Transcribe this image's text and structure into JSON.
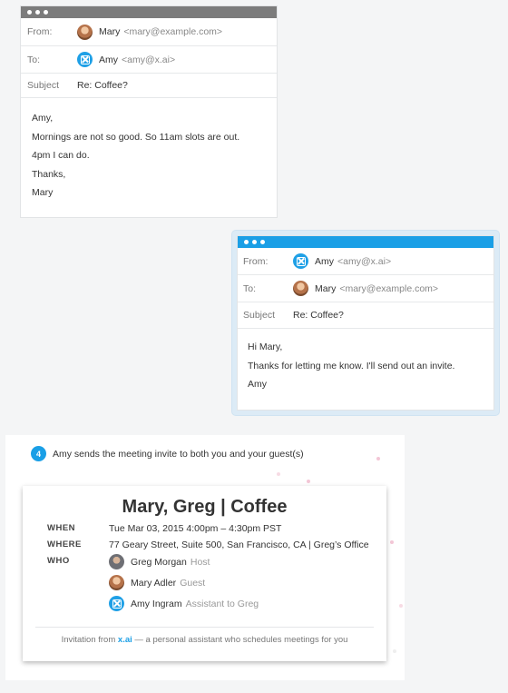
{
  "email1": {
    "from_label": "From:",
    "from_name": "Mary",
    "from_addr": "<mary@example.com>",
    "to_label": "To:",
    "to_name": "Amy",
    "to_addr": "<amy@x.ai>",
    "subject_label": "Subject",
    "subject": "Re: Coffee?",
    "body": [
      "Amy,",
      "Mornings are not so good. So 11am slots are out.",
      "4pm I can do.",
      "Thanks,",
      "Mary"
    ]
  },
  "email2": {
    "from_label": "From:",
    "from_name": "Amy",
    "from_addr": "<amy@x.ai>",
    "to_label": "To:",
    "to_name": "Mary",
    "to_addr": "<mary@example.com>",
    "subject_label": "Subject",
    "subject": "Re: Coffee?",
    "body": [
      "Hi Mary,",
      "Thanks for letting me know. I'll send out an invite.",
      "Amy"
    ]
  },
  "step": {
    "number": "4",
    "text": "Amy sends the meeting invite to both you and your guest(s)"
  },
  "invite": {
    "title": "Mary, Greg | Coffee",
    "when_label": "WHEN",
    "when": "Tue Mar 03, 2015 4:00pm – 4:30pm PST",
    "where_label": "WHERE",
    "where": "77 Geary Street, Suite 500, San Francisco, CA | Greg’s Office",
    "who_label": "WHO",
    "who": [
      {
        "name": "Greg Morgan",
        "role": "Host"
      },
      {
        "name": "Mary Adler",
        "role": "Guest"
      },
      {
        "name": "Amy Ingram",
        "role": "Assistant to Greg"
      }
    ],
    "footer_prefix": "Invitation from",
    "footer_brand": "x.ai",
    "footer_suffix": "— a personal assistant who schedules meetings for you"
  },
  "colors": {
    "accent": "#1a9fe6",
    "titlebar_gray": "#7c7c7c"
  }
}
